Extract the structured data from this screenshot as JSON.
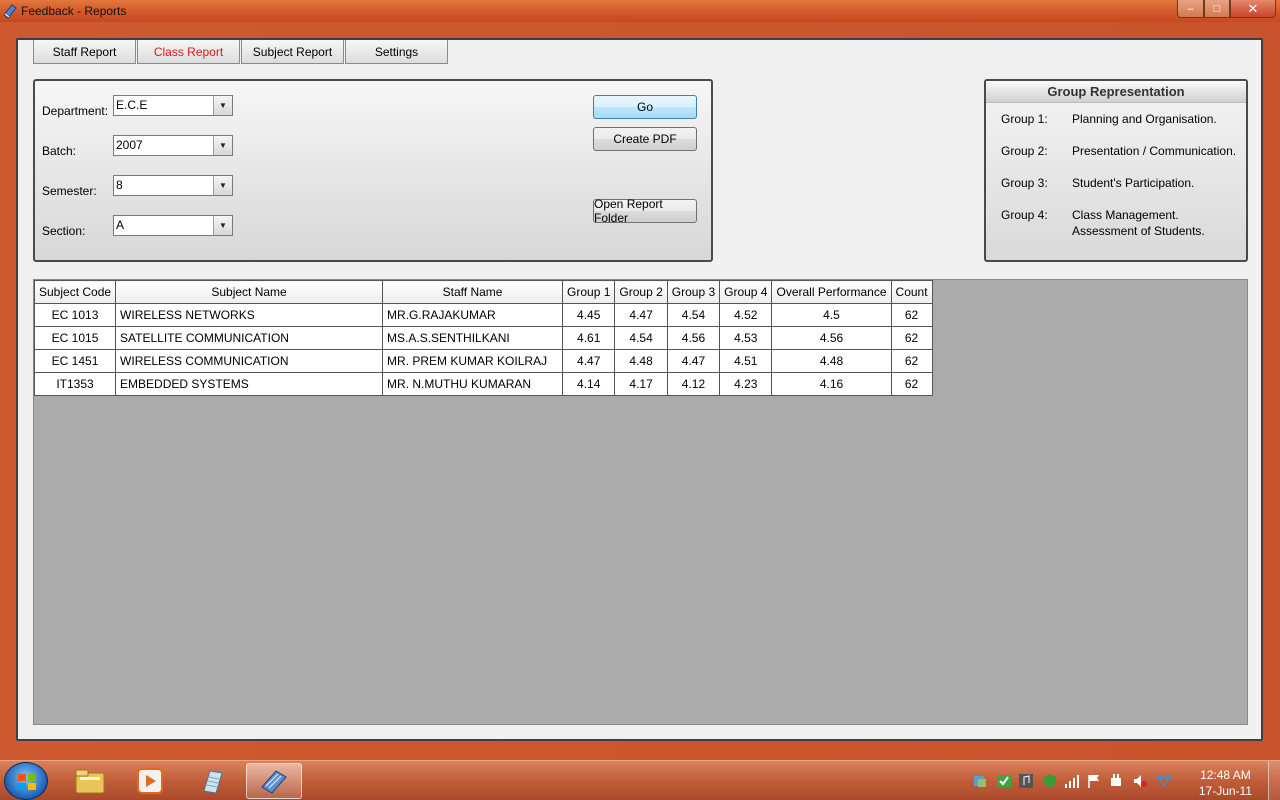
{
  "window": {
    "title": "Feedback - Reports",
    "controls": {
      "minimize": "–",
      "maximize": "□",
      "close": "✕"
    }
  },
  "tabs": [
    {
      "label": "Staff Report",
      "active": false
    },
    {
      "label": "Class Report",
      "active": true
    },
    {
      "label": "Subject Report",
      "active": false
    },
    {
      "label": "Settings",
      "active": false
    }
  ],
  "filters": {
    "department": {
      "label": "Department:",
      "value": "E.C.E"
    },
    "batch": {
      "label": "Batch:",
      "value": "2007"
    },
    "semester": {
      "label": "Semester:",
      "value": "8"
    },
    "section": {
      "label": "Section:",
      "value": "A"
    }
  },
  "buttons": {
    "go": "Go",
    "create_pdf": "Create PDF",
    "open_folder": "Open Report Folder"
  },
  "group_representation": {
    "title": "Group Representation",
    "groups": [
      {
        "key": "Group 1:",
        "desc": "Planning and Organisation.",
        "desc2": ""
      },
      {
        "key": "Group 2:",
        "desc": "Presentation / Communication.",
        "desc2": ""
      },
      {
        "key": "Group 3:",
        "desc": "Student's Participation.",
        "desc2": ""
      },
      {
        "key": "Group 4:",
        "desc": "Class Management.",
        "desc2": "Assessment of Students."
      }
    ]
  },
  "table": {
    "headers": [
      "Subject Code",
      "Subject Name",
      "Staff Name",
      "Group 1",
      "Group 2",
      "Group 3",
      "Group 4",
      "Overall Performance",
      "Count"
    ],
    "rows": [
      [
        "EC 1013",
        "WIRELESS NETWORKS",
        "MR.G.RAJAKUMAR",
        "4.45",
        "4.47",
        "4.54",
        "4.52",
        "4.5",
        "62"
      ],
      [
        "EC 1015",
        "SATELLITE COMMUNICATION",
        "MS.A.S.SENTHILKANI",
        "4.61",
        "4.54",
        "4.56",
        "4.53",
        "4.56",
        "62"
      ],
      [
        "EC 1451",
        "WIRELESS COMMUNICATION",
        "MR. PREM KUMAR KOILRAJ",
        "4.47",
        "4.48",
        "4.47",
        "4.51",
        "4.48",
        "62"
      ],
      [
        "IT1353",
        "EMBEDDED SYSTEMS",
        "MR. N.MUTHU KUMARAN",
        "4.14",
        "4.17",
        "4.12",
        "4.23",
        "4.16",
        "62"
      ]
    ]
  },
  "taskbar": {
    "apps": [
      "folder-icon",
      "media-player-icon",
      "notepad-icon",
      "feedback-app-icon"
    ],
    "time": "12:48 AM",
    "date": "17-Jun-11"
  }
}
